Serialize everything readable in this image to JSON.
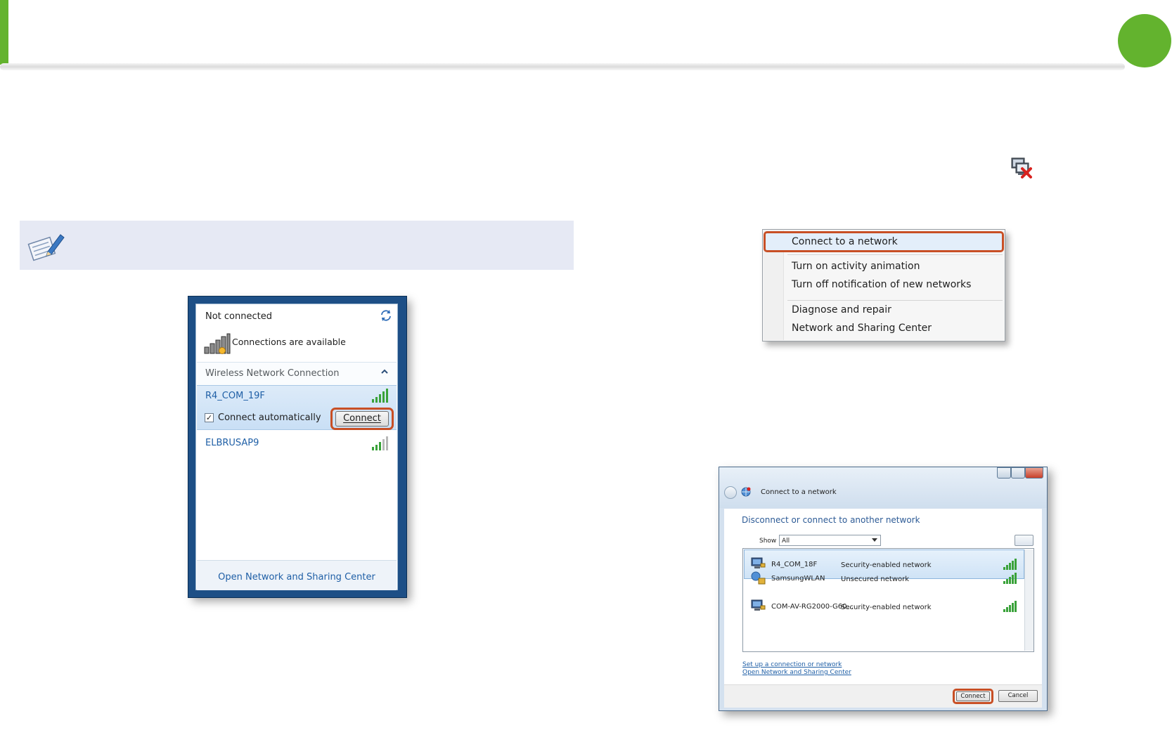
{
  "colors": {
    "accent_green": "#63b32e",
    "highlight_red": "#c84f25",
    "link_blue": "#1f5fa6",
    "note_bg": "#e6e9f4"
  },
  "icons": {
    "note": "pencil-note-icon",
    "tray": "network-disconnected-icon"
  },
  "wifi_popup": {
    "status": "Not connected",
    "available": "Connections are available",
    "section": "Wireless Network Connection",
    "networks": [
      {
        "name": "R4_COM_19F",
        "auto_label": "Connect automatically",
        "auto_checked": true,
        "button": "Connect",
        "signal": 5
      },
      {
        "name": "ELBRUSAP9",
        "signal": 4
      }
    ],
    "footer_link": "Open Network and Sharing Center"
  },
  "context_menu": {
    "items": [
      "Connect to a network",
      "Turn on activity animation",
      "Turn off notification of new networks",
      "Diagnose and repair",
      "Network and Sharing Center"
    ]
  },
  "dialog": {
    "title": "Connect to a network",
    "heading": "Disconnect or connect to another network",
    "show_label": "Show",
    "show_value": "All",
    "networks": [
      {
        "name": "R4_COM_18F",
        "security": "Security-enabled network",
        "signal": 5
      },
      {
        "name": "SamsungWLAN",
        "security": "Unsecured network",
        "signal": 5
      },
      {
        "name": "COM-AV-RG2000-G60...",
        "security": "Security-enabled network",
        "signal": 5
      }
    ],
    "link_setup": "Set up a connection or network",
    "link_center": "Open Network and Sharing Center",
    "connect_button": "Connect",
    "cancel_button": "Cancel"
  }
}
